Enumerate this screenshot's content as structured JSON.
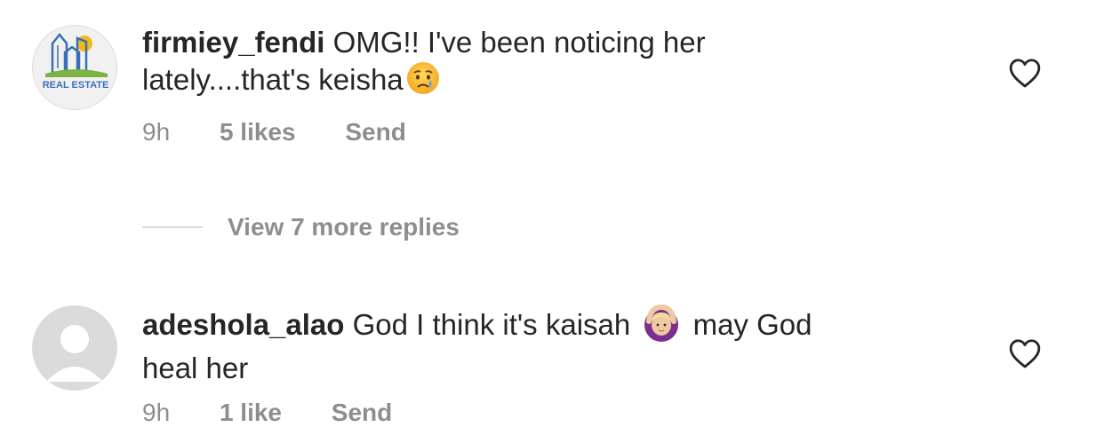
{
  "comments": [
    {
      "username": "firmiey_fendi",
      "text_line1": " OMG!! I've been noticing her",
      "text_line2": "lately....that's keisha",
      "avatar_caption": "REAL ESTATE",
      "time": "9h",
      "likes": "5 likes",
      "reply_label": "Send",
      "emoji": "crying-face"
    },
    {
      "username": "adeshola_alao",
      "text_part1": " God I think it's kaisah",
      "text_part2": "may God",
      "text_line2": "heal her",
      "time": "9h",
      "likes": "1 like",
      "reply_label": "Send",
      "emoji": "person-gesturing-ok"
    }
  ],
  "view_replies": {
    "label": "View 7 more replies"
  },
  "colors": {
    "text": "#262626",
    "secondary": "#8e8e8e",
    "divider": "#dbdbdb",
    "logo_blue": "#3b6fb6",
    "logo_yellow": "#f5b819",
    "logo_green": "#7bb241"
  }
}
